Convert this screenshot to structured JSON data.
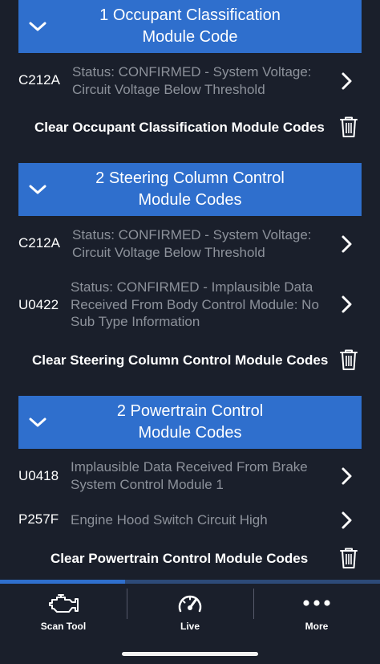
{
  "sections": [
    {
      "title_line1": "1 Occupant Classification",
      "title_line2": "Module Code",
      "codes": [
        {
          "code": "C212A",
          "desc_line1": "Status: CONFIRMED - System Voltage:",
          "desc_line2": "Circuit Voltage Below Threshold",
          "desc_line3": ""
        }
      ],
      "clear_label": "Clear Occupant Classification Module Codes"
    },
    {
      "title_line1": "2 Steering Column Control",
      "title_line2": "Module Codes",
      "codes": [
        {
          "code": "C212A",
          "desc_line1": "Status: CONFIRMED - System Voltage:",
          "desc_line2": "Circuit Voltage Below Threshold",
          "desc_line3": ""
        },
        {
          "code": "U0422",
          "desc_line1": "Status: CONFIRMED - Implausible Data",
          "desc_line2": "Received From Body Control Module: No",
          "desc_line3": "Sub Type Information"
        }
      ],
      "clear_label": "Clear Steering Column Control Module Codes"
    },
    {
      "title_line1": "2 Powertrain Control",
      "title_line2": "Module Codes",
      "codes": [
        {
          "code": "U0418",
          "desc_line1": "Implausible Data Received From Brake",
          "desc_line2": "System Control Module 1",
          "desc_line3": ""
        },
        {
          "code": "P257F",
          "desc_line1": "Engine Hood Switch Circuit High",
          "desc_line2": "",
          "desc_line3": ""
        }
      ],
      "clear_label": "Clear Powertrain Control Module Codes"
    }
  ],
  "progress": {
    "fraction": 0.33
  },
  "tabs": [
    {
      "label": "Scan Tool",
      "icon": "engine-icon"
    },
    {
      "label": "Live",
      "icon": "gauge-icon"
    },
    {
      "label": "More",
      "icon": "more-dots-icon"
    }
  ],
  "colors": {
    "background": "#1a1f2b",
    "header_blue": "#2f6fcd",
    "desc_gray": "#8d929b",
    "text_white": "#ffffff"
  }
}
